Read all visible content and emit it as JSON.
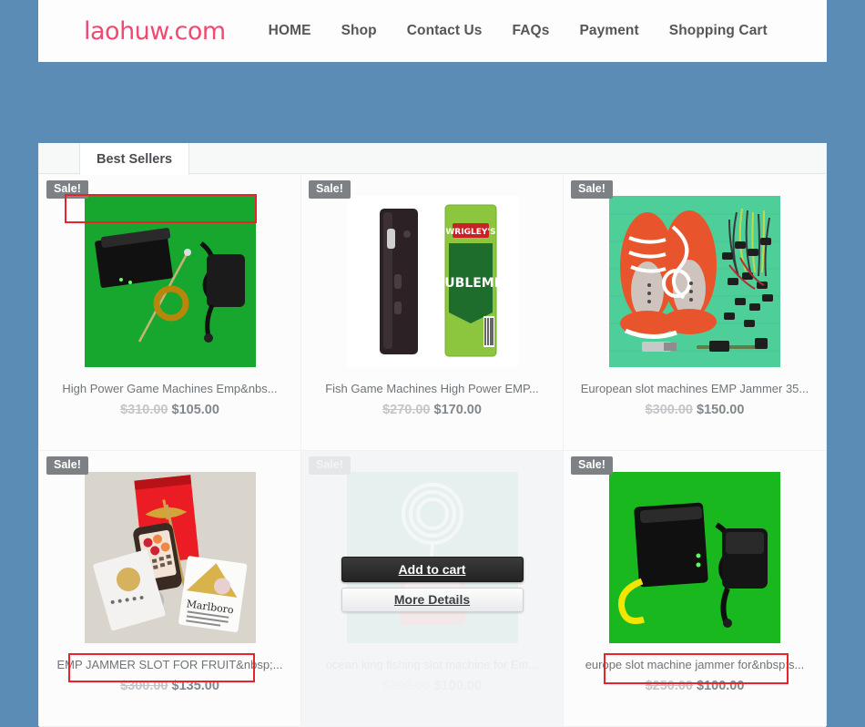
{
  "site": {
    "logo_text": "laohuw.com",
    "logo_color": "#ef4a72"
  },
  "nav": {
    "items": [
      {
        "label": "HOME"
      },
      {
        "label": "Shop"
      },
      {
        "label": "Contact Us"
      },
      {
        "label": "FAQs"
      },
      {
        "label": "Payment"
      },
      {
        "label": "Shopping Cart"
      }
    ]
  },
  "tabs": [
    {
      "label": "Best Sellers",
      "active": true
    }
  ],
  "hover_card": {
    "add_to_cart_label": "Add to cart",
    "more_details_label": "More Details"
  },
  "badges": {
    "sale_label": "Sale!",
    "sale_bg": "#7d8084"
  },
  "annotation": {
    "outline_color": "#e8242a"
  },
  "products": [
    {
      "title": "High Power Game Machines Emp&nbs...",
      "old_price": "$310.00",
      "new_price": "$105.00",
      "sale": "Sale!",
      "highlighted": true,
      "hovered": false,
      "image": "emp-jammer-black-box-green-bg"
    },
    {
      "title": "Fish Game Machines High Power EMP...",
      "old_price": "$270.00",
      "new_price": "$170.00",
      "sale": "Sale!",
      "highlighted": false,
      "hovered": false,
      "image": "black-stick-jammer-with-doublemint-gum"
    },
    {
      "title": "European slot machines EMP Jammer 35...",
      "old_price": "$300.00",
      "new_price": "$150.00",
      "sale": "Sale!",
      "highlighted": false,
      "hovered": false,
      "image": "orange-shoes-with-wire-coils"
    },
    {
      "title": "EMP JAMMER SLOT FOR FRUIT&nbsp;...",
      "old_price": "$300.00",
      "new_price": "$135.00",
      "sale": "Sale!",
      "highlighted": true,
      "hovered": false,
      "image": "red-box-phone-keyfob-marlboro-pack"
    },
    {
      "title": "ocean king fishing slot machine for Em...",
      "old_price": "$200.00",
      "new_price": "$100.00",
      "sale": "Sale!",
      "highlighted": false,
      "hovered": true,
      "image": "coil-antenna-device-faded"
    },
    {
      "title": "europe slot machine jammer for&nbsp;s...",
      "old_price": "$250.00",
      "new_price": "$100.00",
      "sale": "Sale!",
      "highlighted": true,
      "hovered": false,
      "image": "black-box-with-yellow-cable-green-bg"
    }
  ]
}
